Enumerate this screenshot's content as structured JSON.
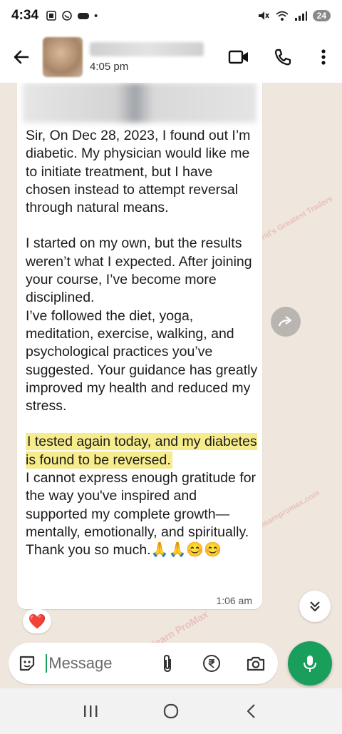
{
  "status_bar": {
    "time": "4:34",
    "battery": "24"
  },
  "header": {
    "last_seen": "4:05 pm"
  },
  "watermark": {
    "brand": "Elearn ProMax",
    "tagline": "Creating World's Greatest Traders",
    "url": "www.elearnpromax.com"
  },
  "message": {
    "paragraphs": [
      "Sir, On Dec 28, 2023, I found out I’m diabetic. My physician would like me to initiate treatment, but I have chosen instead to attempt reversal through natural means.",
      "I started on my own, but the results weren’t what I expected. After joining your course, I’ve become more disciplined.",
      "I’ve followed the diet, yoga, meditation, exercise, walking, and psychological practices you’ve suggested. Your guidance has greatly improved my health and reduced my stress."
    ],
    "highlight": "I tested again today, and my diabetes is found to be reversed.",
    "after_highlight": "I cannot express enough gratitude for the way you've inspired and supported my complete growth—mentally, emotionally, and spiritually.",
    "thanks": "Thank you so much.",
    "thanks_emojis": "🙏🙏😊😊",
    "time": "1:06 am",
    "reaction": "❤️"
  },
  "composer": {
    "placeholder": "Message"
  },
  "icons": {
    "back": "back-arrow-icon",
    "video": "video-call-icon",
    "call": "phone-call-icon",
    "menu": "more-vert-icon",
    "forward": "forward-icon",
    "scroll": "double-chevron-down-icon",
    "sticker": "sticker-icon",
    "attach": "paperclip-icon",
    "payment": "rupee-icon",
    "camera": "camera-icon",
    "mic": "mic-icon"
  },
  "colors": {
    "accent_green": "#1a9e5c",
    "highlight_yellow": "#f7ec8c",
    "chat_bg": "#efe7de"
  }
}
